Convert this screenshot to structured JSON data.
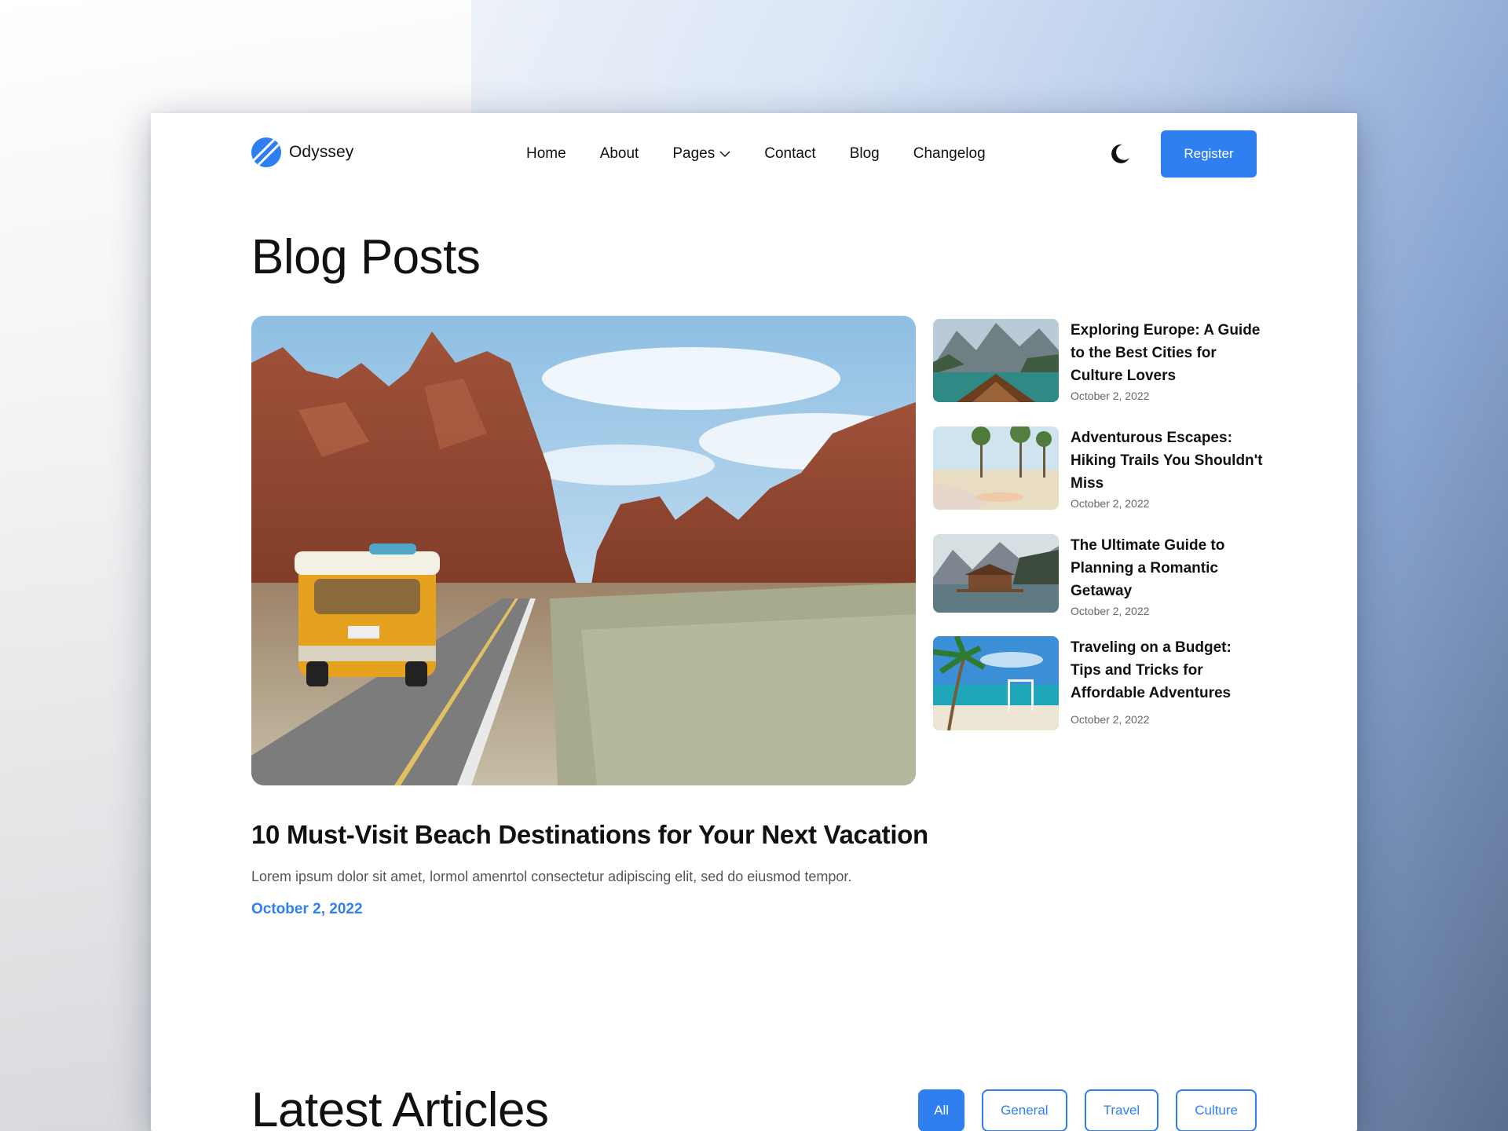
{
  "brand": {
    "name": "Odyssey"
  },
  "nav": {
    "items": [
      {
        "label": "Home"
      },
      {
        "label": "About"
      },
      {
        "label": "Pages",
        "has_dropdown": true
      },
      {
        "label": "Contact"
      },
      {
        "label": "Blog"
      },
      {
        "label": "Changelog"
      }
    ],
    "theme_toggle_icon": "moon-icon",
    "register_label": "Register"
  },
  "page": {
    "title": "Blog Posts"
  },
  "featured": {
    "image": "desert-road-van",
    "title": "10 Must-Visit Beach Destinations for Your Next Vacation",
    "excerpt": "Lorem ipsum dolor sit amet, lormol amenrtol consectetur adipiscing elit, sed do eiusmod tempor.",
    "date": "October 2, 2022"
  },
  "side_posts": [
    {
      "title": "Exploring Europe: A Guide to the Best Cities for Culture Lovers",
      "date": "October 2, 2022",
      "image": "mountain-lake-boat"
    },
    {
      "title": "Adventurous Escapes: Hiking Trails You Shouldn't Miss",
      "date": "October 2, 2022",
      "image": "beach-palms-relax"
    },
    {
      "title": "The Ultimate Guide to Planning a Romantic Getaway",
      "date": "October 2, 2022",
      "image": "lake-cabin-mountains"
    },
    {
      "title": "Traveling on a Budget: Tips and Tricks for Affordable Adventures",
      "date": "October 2, 2022",
      "image": "tropical-beach-swing"
    }
  ],
  "latest": {
    "title": "Latest Articles",
    "filters": [
      {
        "label": "All",
        "active": true
      },
      {
        "label": "General",
        "active": false
      },
      {
        "label": "Travel",
        "active": false
      },
      {
        "label": "Culture",
        "active": false
      }
    ]
  },
  "colors": {
    "accent": "#2f7ff0",
    "text": "#111111",
    "muted": "#555555"
  }
}
